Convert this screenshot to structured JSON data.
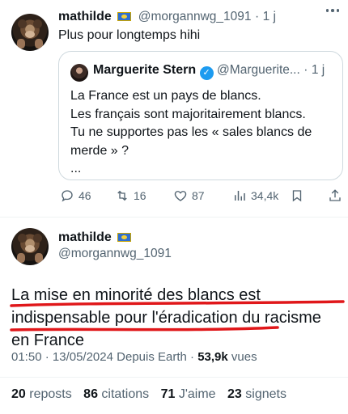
{
  "reply": {
    "display_name": "mathilde",
    "handle": "@morgannwg_1091",
    "separator": "·",
    "time": "1 j",
    "text": "Plus pour longtemps hihi",
    "quote": {
      "display_name": "Marguerite Stern",
      "handle": "@Marguerite...",
      "separator": "·",
      "time": "1 j",
      "lines": [
        "La France est un pays de blancs.",
        "Les français sont majoritairement blancs.",
        "Tu ne supportes pas les « sales blancs de merde » ?",
        "..."
      ]
    },
    "actions": {
      "replies": "46",
      "reposts": "16",
      "likes": "87",
      "views": "34,4k"
    }
  },
  "main": {
    "display_name": "mathilde",
    "handle": "@morgannwg_1091",
    "text": "La mise en minorité des blancs est indispensable pour l'éradication du racisme en France",
    "meta": {
      "time": "01:50",
      "separator": "·",
      "date": "13/05/2024",
      "source": "Depuis Earth",
      "views_value": "53,9k",
      "views_label": "vues"
    },
    "stats": {
      "reposts_value": "20",
      "reposts_label": "reposts",
      "citations_value": "86",
      "citations_label": "citations",
      "likes_value": "71",
      "likes_label": "J'aime",
      "bookmarks_value": "23",
      "bookmarks_label": "signets"
    }
  },
  "colors": {
    "text": "#0f1419",
    "muted": "#536471",
    "verified": "#1d9bf0",
    "annotation_red": "#e0171a",
    "border": "#cfd9de"
  }
}
